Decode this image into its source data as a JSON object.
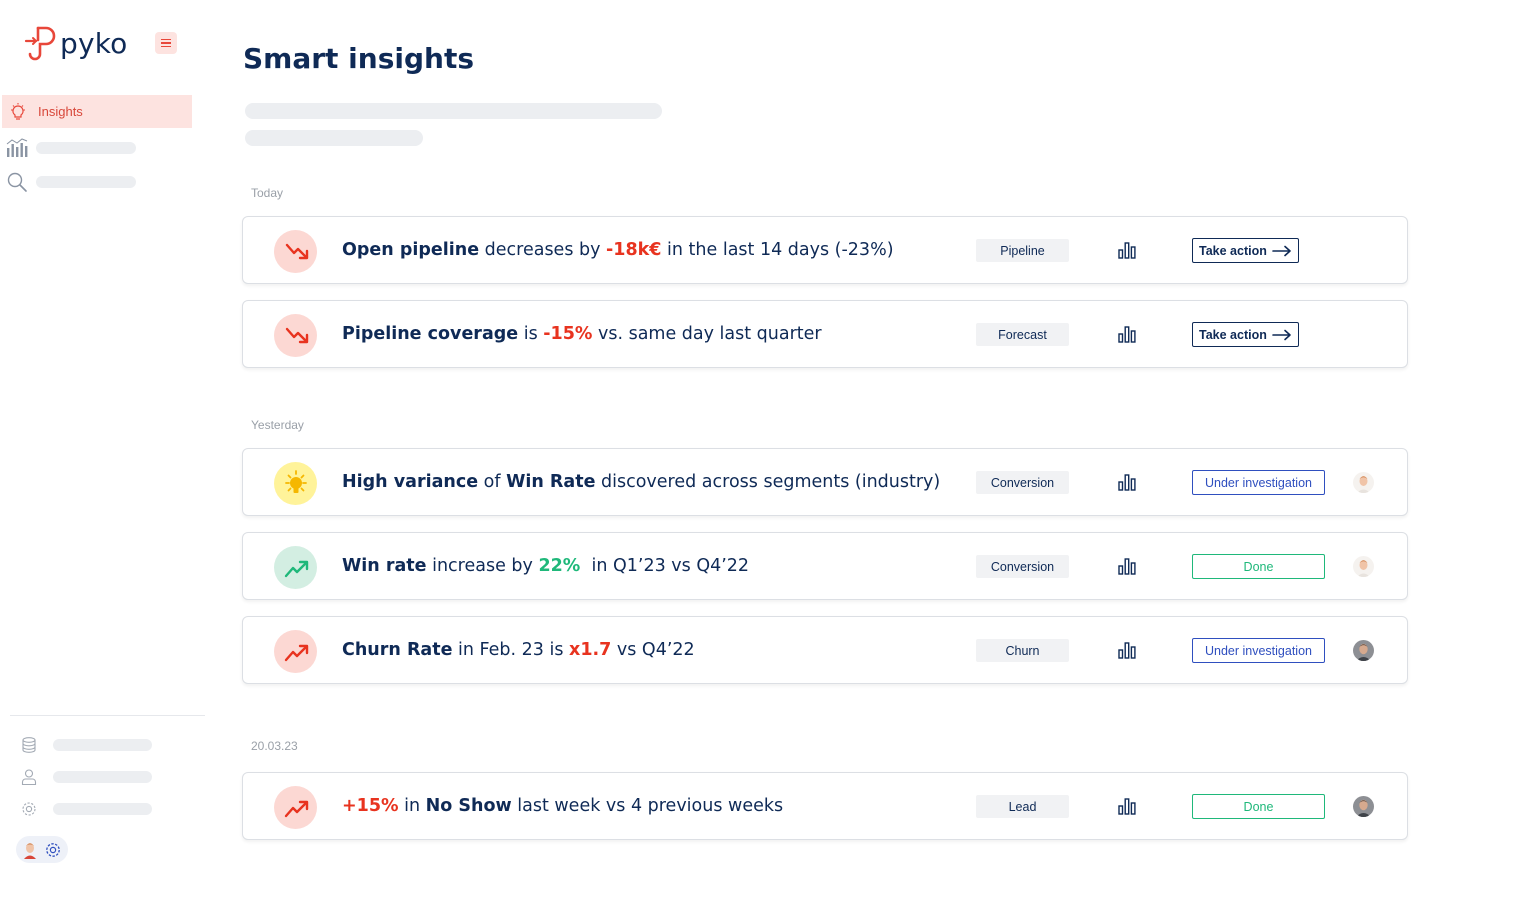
{
  "brand": {
    "name": "pyko",
    "accent": "#e8473a",
    "navy": "#0f2a56"
  },
  "sidebar": {
    "active_item": {
      "label": "Insights",
      "icon": "lightbulb-icon"
    },
    "items": [
      {
        "icon": "bar-chart-icon"
      },
      {
        "icon": "search-icon"
      }
    ],
    "bottom_items": [
      {
        "icon": "database-icon"
      },
      {
        "icon": "user-icon"
      },
      {
        "icon": "gear-icon"
      }
    ]
  },
  "header": {
    "title": "Smart insights"
  },
  "sections": [
    {
      "label": "Today",
      "cards": [
        {
          "trend": "down",
          "parts": [
            {
              "t": "Open pipeline",
              "s": "bold"
            },
            {
              "t": " decreases by ",
              "s": "normal"
            },
            {
              "t": "-18k€",
              "s": "red"
            },
            {
              "t": " in the last 14 days (-23%)",
              "s": "normal"
            }
          ],
          "tag": "Pipeline",
          "action": {
            "kind": "take",
            "label": "Take action"
          }
        },
        {
          "trend": "down",
          "parts": [
            {
              "t": "Pipeline coverage",
              "s": "bold"
            },
            {
              "t": " is ",
              "s": "normal"
            },
            {
              "t": "-15%",
              "s": "red"
            },
            {
              "t": " vs. same day last quarter",
              "s": "normal"
            }
          ],
          "tag": "Forecast",
          "action": {
            "kind": "take",
            "label": "Take action"
          }
        }
      ]
    },
    {
      "label": "Yesterday",
      "cards": [
        {
          "trend": "idea",
          "parts": [
            {
              "t": "High variance",
              "s": "bold"
            },
            {
              "t": " of ",
              "s": "normal"
            },
            {
              "t": "Win Rate",
              "s": "bold"
            },
            {
              "t": " discovered across segments (industry)",
              "s": "normal"
            }
          ],
          "tag": "Conversion",
          "action": {
            "kind": "inv",
            "label": "Under investigation"
          },
          "avatar": "light"
        },
        {
          "trend": "up-good",
          "parts": [
            {
              "t": "Win rate",
              "s": "bold"
            },
            {
              "t": " increase by ",
              "s": "normal"
            },
            {
              "t": "22%",
              "s": "green"
            },
            {
              "t": "  in Q1’23 vs Q4’22",
              "s": "normal"
            }
          ],
          "tag": "Conversion",
          "action": {
            "kind": "done",
            "label": "Done"
          },
          "avatar": "light"
        },
        {
          "trend": "up-bad",
          "parts": [
            {
              "t": "Churn Rate",
              "s": "bold"
            },
            {
              "t": " in Feb. 23 is ",
              "s": "normal"
            },
            {
              "t": "x1.7",
              "s": "red"
            },
            {
              "t": " vs Q4’22",
              "s": "normal"
            }
          ],
          "tag": "Churn",
          "action": {
            "kind": "inv",
            "label": "Under investigation"
          },
          "avatar": "dark"
        }
      ]
    },
    {
      "label": "20.03.23",
      "cards": [
        {
          "trend": "up-bad",
          "parts": [
            {
              "t": "+15%",
              "s": "red"
            },
            {
              "t": " in ",
              "s": "normal"
            },
            {
              "t": "No Show",
              "s": "bold"
            },
            {
              "t": " last week vs 4 previous weeks",
              "s": "normal"
            }
          ],
          "tag": "Lead",
          "action": {
            "kind": "done",
            "label": "Done"
          },
          "avatar": "dark"
        }
      ]
    }
  ]
}
